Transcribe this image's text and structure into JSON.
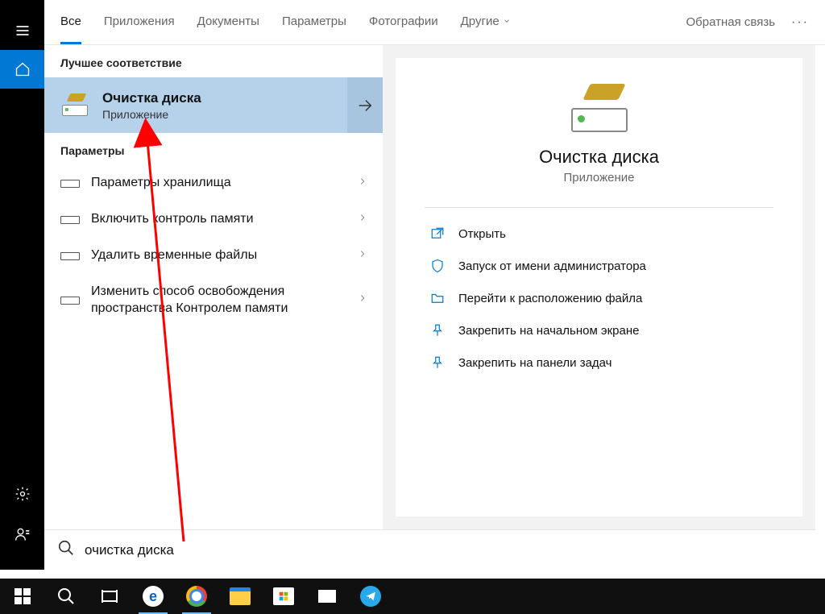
{
  "tabs": {
    "all": "Все",
    "apps": "Приложения",
    "docs": "Документы",
    "settings": "Параметры",
    "photos": "Фотографии",
    "more": "Другие"
  },
  "header": {
    "feedback": "Обратная связь"
  },
  "results": {
    "best_match_header": "Лучшее соответствие",
    "best_match": {
      "title": "Очистка диска",
      "subtitle": "Приложение"
    },
    "settings_header": "Параметры",
    "settings_items": [
      "Параметры хранилища",
      "Включить контроль памяти",
      "Удалить временные файлы",
      "Изменить способ освобождения пространства Контролем памяти"
    ]
  },
  "preview": {
    "title": "Очистка диска",
    "subtitle": "Приложение",
    "actions": [
      "Открыть",
      "Запуск от имени администратора",
      "Перейти к расположению файла",
      "Закрепить на начальном экране",
      "Закрепить на панели задач"
    ]
  },
  "search": {
    "query": "очистка диска"
  }
}
